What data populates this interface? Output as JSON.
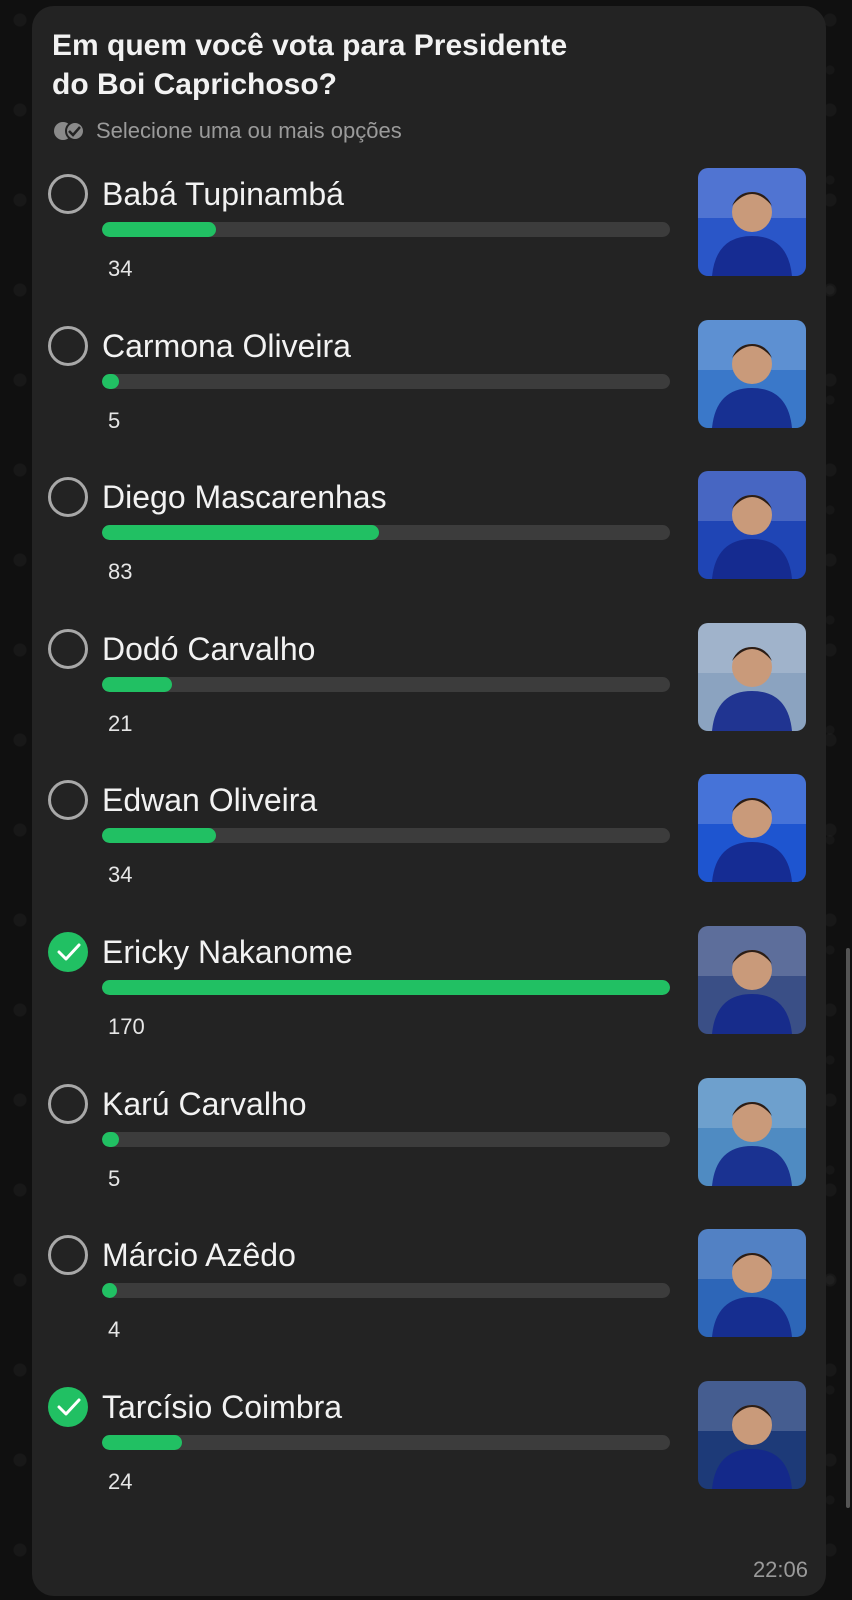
{
  "poll": {
    "question": "Em quem você vota para Presidente do Boi Caprichoso?",
    "hint": "Selecione uma ou mais opções",
    "max_votes": 170,
    "options": [
      {
        "label": "Babá Tupinambá",
        "votes": "34",
        "checked": false,
        "photo_color": "#2a56c8"
      },
      {
        "label": "Carmona Oliveira",
        "votes": "5",
        "checked": false,
        "photo_color": "#3a78c9"
      },
      {
        "label": "Diego Mascarenhas",
        "votes": "83",
        "checked": false,
        "photo_color": "#1f45b5"
      },
      {
        "label": "Dodó Carvalho",
        "votes": "21",
        "checked": false,
        "photo_color": "#8ba3c0"
      },
      {
        "label": "Edwan Oliveira",
        "votes": "34",
        "checked": false,
        "photo_color": "#1e55d0"
      },
      {
        "label": "Ericky Nakanome",
        "votes": "170",
        "checked": true,
        "photo_color": "#3a4f86"
      },
      {
        "label": "Karú Carvalho",
        "votes": "5",
        "checked": false,
        "photo_color": "#4f8bc2"
      },
      {
        "label": "Márcio Azêdo",
        "votes": "4",
        "checked": false,
        "photo_color": "#2d66b8"
      },
      {
        "label": "Tarcísio Coimbra",
        "votes": "24",
        "checked": true,
        "photo_color": "#1d3a78"
      }
    ],
    "timestamp": "22:06"
  },
  "colors": {
    "accent": "#21c063",
    "bubble": "#232323",
    "track": "#3c3c3c"
  }
}
